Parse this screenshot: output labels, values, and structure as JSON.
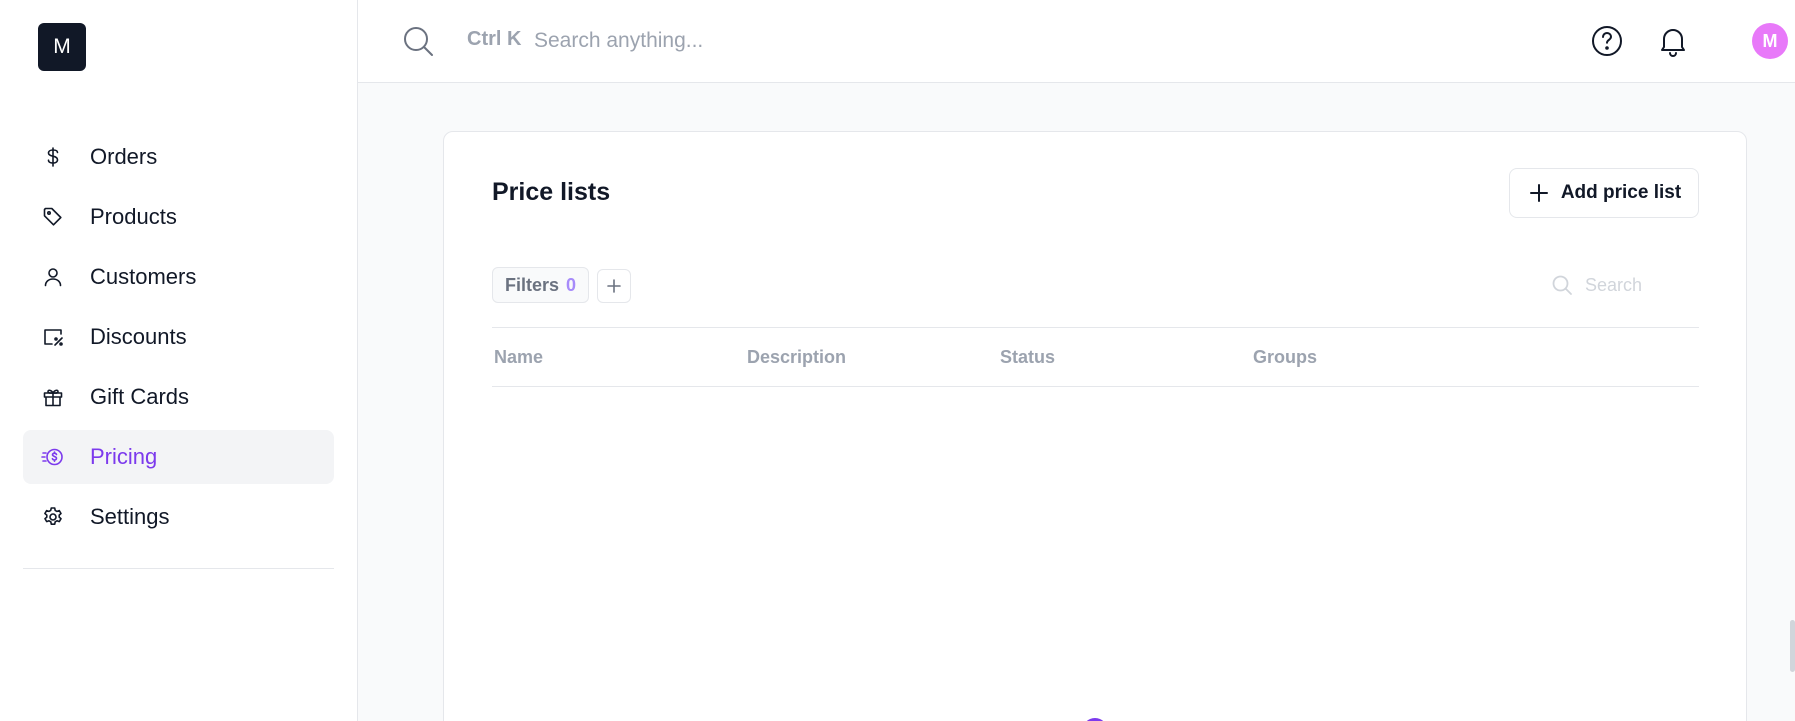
{
  "logo_letter": "M",
  "sidebar": {
    "items": [
      {
        "label": "Orders",
        "icon": "dollar-icon"
      },
      {
        "label": "Products",
        "icon": "tag-icon"
      },
      {
        "label": "Customers",
        "icon": "user-icon"
      },
      {
        "label": "Discounts",
        "icon": "receipt-percent-icon"
      },
      {
        "label": "Gift Cards",
        "icon": "gift-icon"
      },
      {
        "label": "Pricing",
        "icon": "pricing-icon",
        "active": true
      },
      {
        "label": "Settings",
        "icon": "gear-icon"
      }
    ]
  },
  "topbar": {
    "shortcut": "Ctrl K",
    "search_placeholder": "Search anything...",
    "avatar_letter": "M",
    "avatar_color": "#e879f9"
  },
  "main": {
    "title": "Price lists",
    "add_button_label": "Add price list",
    "filters_label": "Filters",
    "filters_count": "0",
    "search_placeholder": "Search",
    "columns": [
      "Name",
      "Description",
      "Status",
      "Groups"
    ]
  },
  "colors": {
    "accent": "#7c3aed",
    "text": "#111827",
    "muted": "#9ca3af"
  }
}
